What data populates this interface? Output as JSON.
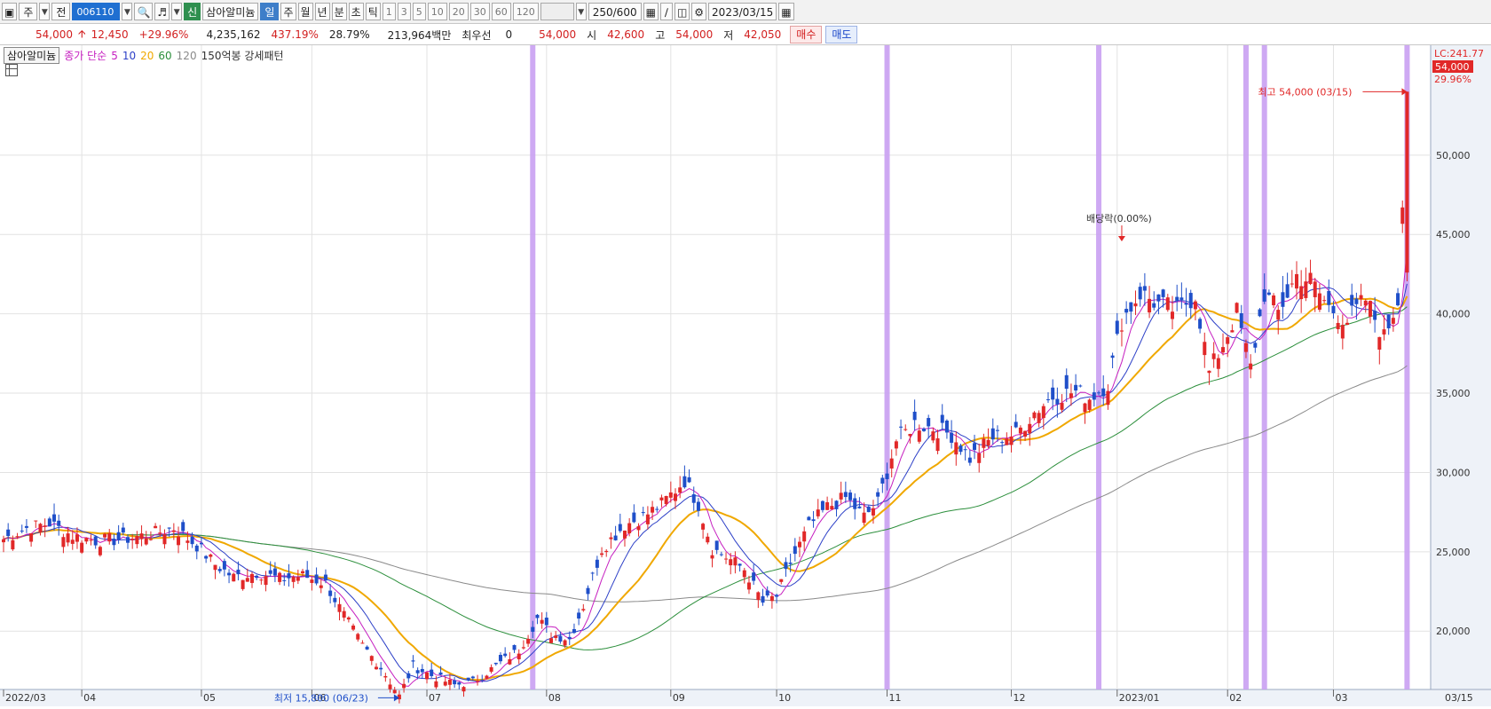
{
  "toolbar": {
    "period_label": "주",
    "prev_label": "전",
    "code": "006110",
    "new_badge": "신",
    "stock_name": "삼아알미늄",
    "periods": [
      "일",
      "주",
      "월",
      "년",
      "분",
      "초",
      "틱"
    ],
    "active_period": "일",
    "minutes": [
      "1",
      "3",
      "5",
      "10",
      "20",
      "30",
      "60",
      "120"
    ],
    "count_display": "250/600",
    "date": "2023/03/15"
  },
  "quote": {
    "price": "54,000",
    "change": "12,450",
    "change_pct": "+29.96%",
    "volume": "4,235,162",
    "volume_ratio": "437.19%",
    "turnover": "28.79%",
    "amount": "213,964백만",
    "priority_label": "최우선",
    "priority_value": "0",
    "sell_price": "54,000",
    "open_label": "시",
    "open": "42,600",
    "high_label": "고",
    "high": "54,000",
    "low_label": "저",
    "low": "42,050",
    "buy_button": "매수",
    "sell_button": "매도"
  },
  "legend": {
    "name": "삼아알미늄",
    "ma_label": "종가 단순",
    "ma_periods": [
      "5",
      "10",
      "20",
      "60",
      "120"
    ],
    "pattern": "150억봉 강세패턴"
  },
  "colors": {
    "up": "#e12828",
    "down": "#1f4fc9",
    "ma5": "#c61fc0",
    "ma10": "#2c3fc7",
    "ma20": "#f0a800",
    "ma60": "#2c8f3c",
    "ma120": "#8a8a8a",
    "highlight": "#c9a0f2"
  },
  "chart_data": {
    "type": "candlestick",
    "ylim": [
      15000,
      55000
    ],
    "yticks": [
      20000,
      25000,
      30000,
      35000,
      40000,
      45000,
      50000
    ],
    "ytick_labels": [
      "20,000",
      "25,000",
      "30,000",
      "35,000",
      "40,000",
      "45,000",
      "50,000"
    ],
    "right_labels": {
      "lc": "LC:241.77",
      "price": "54,000",
      "pct": "29.96%"
    },
    "month_labels": [
      {
        "label": "2022/03",
        "idx": 0
      },
      {
        "label": "04",
        "idx": 17
      },
      {
        "label": "05",
        "idx": 43
      },
      {
        "label": "06",
        "idx": 67
      },
      {
        "label": "07",
        "idx": 92
      },
      {
        "label": "08",
        "idx": 118
      },
      {
        "label": "09",
        "idx": 145
      },
      {
        "label": "10",
        "idx": 168
      },
      {
        "label": "11",
        "idx": 192
      },
      {
        "label": "12",
        "idx": 219
      },
      {
        "label": "2023/01",
        "idx": 242
      },
      {
        "label": "02",
        "idx": 266
      },
      {
        "label": "03",
        "idx": 289
      },
      {
        "label": "03/15",
        "idx": 300
      }
    ],
    "highlight_idx": [
      115,
      192,
      238,
      270,
      274,
      305
    ],
    "annotations": {
      "high": {
        "text": "최고 54,000 (03/15)",
        "idx": 305,
        "value": 54000
      },
      "low": {
        "text": "최저 15,800 (06/23)",
        "idx": 86,
        "value": 15800
      },
      "dividend": {
        "text": "배당락(0.00%)",
        "idx": 243
      }
    },
    "anchors": [
      [
        0,
        25800
      ],
      [
        5,
        26500
      ],
      [
        10,
        26800
      ],
      [
        15,
        26000
      ],
      [
        20,
        25700
      ],
      [
        26,
        25800
      ],
      [
        32,
        26100
      ],
      [
        37,
        26500
      ],
      [
        42,
        25400
      ],
      [
        46,
        24200
      ],
      [
        50,
        23400
      ],
      [
        55,
        23700
      ],
      [
        60,
        23300
      ],
      [
        65,
        23500
      ],
      [
        70,
        23000
      ],
      [
        74,
        21000
      ],
      [
        78,
        19100
      ],
      [
        82,
        17700
      ],
      [
        86,
        15900
      ],
      [
        89,
        17800
      ],
      [
        93,
        17200
      ],
      [
        98,
        16600
      ],
      [
        102,
        16800
      ],
      [
        107,
        17800
      ],
      [
        112,
        18800
      ],
      [
        116,
        20800
      ],
      [
        119,
        19800
      ],
      [
        123,
        19500
      ],
      [
        126,
        21600
      ],
      [
        130,
        25200
      ],
      [
        135,
        26700
      ],
      [
        139,
        27200
      ],
      [
        143,
        28000
      ],
      [
        148,
        29500
      ],
      [
        151,
        28000
      ],
      [
        154,
        25200
      ],
      [
        158,
        24500
      ],
      [
        161,
        23900
      ],
      [
        165,
        21800
      ],
      [
        168,
        22200
      ],
      [
        171,
        24300
      ],
      [
        175,
        26600
      ],
      [
        179,
        27800
      ],
      [
        183,
        28400
      ],
      [
        187,
        27200
      ],
      [
        190,
        28100
      ],
      [
        194,
        32000
      ],
      [
        198,
        33100
      ],
      [
        202,
        32800
      ],
      [
        206,
        32400
      ],
      [
        210,
        30900
      ],
      [
        215,
        32200
      ],
      [
        220,
        32400
      ],
      [
        224,
        33800
      ],
      [
        228,
        34800
      ],
      [
        233,
        35100
      ],
      [
        236,
        34700
      ],
      [
        240,
        35600
      ],
      [
        243,
        39600
      ],
      [
        247,
        41300
      ],
      [
        251,
        40600
      ],
      [
        255,
        40200
      ],
      [
        259,
        41200
      ],
      [
        262,
        36300
      ],
      [
        265,
        38100
      ],
      [
        268,
        40100
      ],
      [
        271,
        36600
      ],
      [
        274,
        41300
      ],
      [
        277,
        40100
      ],
      [
        281,
        42400
      ],
      [
        284,
        42100
      ],
      [
        288,
        40400
      ],
      [
        292,
        39600
      ],
      [
        296,
        40900
      ],
      [
        300,
        38500
      ],
      [
        303,
        40900
      ],
      [
        305,
        54000
      ]
    ]
  }
}
